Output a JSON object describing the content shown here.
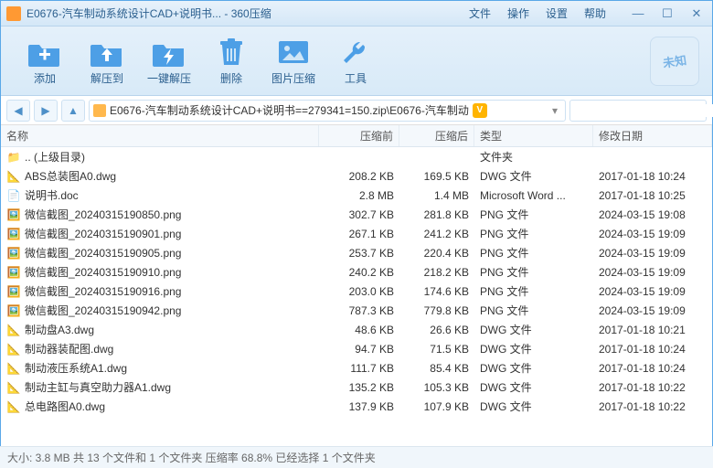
{
  "title": "E0676-汽车制动系统设计CAD+说明书... - 360压缩",
  "menu": {
    "file": "文件",
    "op": "操作",
    "set": "设置",
    "help": "帮助"
  },
  "tools": {
    "add": "添加",
    "extract": "解压到",
    "oneclick": "一键解压",
    "delete": "删除",
    "imgcomp": "图片压缩",
    "toolbox": "工具"
  },
  "badge": "未知",
  "path": "E0676-汽车制动系统设计CAD+说明书==279341=150.zip\\E0676-汽车制动",
  "vip": "V",
  "cols": {
    "name": "名称",
    "before": "压缩前",
    "after": "压缩后",
    "type": "类型",
    "date": "修改日期"
  },
  "rows": [
    {
      "icon": "folder",
      "name": ".. (上级目录)",
      "before": "",
      "after": "",
      "type": "文件夹",
      "date": ""
    },
    {
      "icon": "dwg",
      "name": "ABS总装图A0.dwg",
      "before": "208.2 KB",
      "after": "169.5 KB",
      "type": "DWG 文件",
      "date": "2017-01-18 10:24"
    },
    {
      "icon": "doc",
      "name": "说明书.doc",
      "before": "2.8 MB",
      "after": "1.4 MB",
      "type": "Microsoft Word ...",
      "date": "2017-01-18 10:25"
    },
    {
      "icon": "png",
      "name": "微信截图_20240315190850.png",
      "before": "302.7 KB",
      "after": "281.8 KB",
      "type": "PNG 文件",
      "date": "2024-03-15 19:08"
    },
    {
      "icon": "png",
      "name": "微信截图_20240315190901.png",
      "before": "267.1 KB",
      "after": "241.2 KB",
      "type": "PNG 文件",
      "date": "2024-03-15 19:09"
    },
    {
      "icon": "png",
      "name": "微信截图_20240315190905.png",
      "before": "253.7 KB",
      "after": "220.4 KB",
      "type": "PNG 文件",
      "date": "2024-03-15 19:09"
    },
    {
      "icon": "png",
      "name": "微信截图_20240315190910.png",
      "before": "240.2 KB",
      "after": "218.2 KB",
      "type": "PNG 文件",
      "date": "2024-03-15 19:09"
    },
    {
      "icon": "png",
      "name": "微信截图_20240315190916.png",
      "before": "203.0 KB",
      "after": "174.6 KB",
      "type": "PNG 文件",
      "date": "2024-03-15 19:09"
    },
    {
      "icon": "png",
      "name": "微信截图_20240315190942.png",
      "before": "787.3 KB",
      "after": "779.8 KB",
      "type": "PNG 文件",
      "date": "2024-03-15 19:09"
    },
    {
      "icon": "dwg",
      "name": "制动盘A3.dwg",
      "before": "48.6 KB",
      "after": "26.6 KB",
      "type": "DWG 文件",
      "date": "2017-01-18 10:21"
    },
    {
      "icon": "dwg",
      "name": "制动器装配图.dwg",
      "before": "94.7 KB",
      "after": "71.5 KB",
      "type": "DWG 文件",
      "date": "2017-01-18 10:24"
    },
    {
      "icon": "dwg",
      "name": "制动液压系统A1.dwg",
      "before": "111.7 KB",
      "after": "85.4 KB",
      "type": "DWG 文件",
      "date": "2017-01-18 10:24"
    },
    {
      "icon": "dwg",
      "name": "制动主缸与真空助力器A1.dwg",
      "before": "135.2 KB",
      "after": "105.3 KB",
      "type": "DWG 文件",
      "date": "2017-01-18 10:22"
    },
    {
      "icon": "dwg",
      "name": "总电路图A0.dwg",
      "before": "137.9 KB",
      "after": "107.9 KB",
      "type": "DWG 文件",
      "date": "2017-01-18 10:22"
    }
  ],
  "status": "大小: 3.8 MB 共 13 个文件和 1 个文件夹 压缩率 68.8%  已经选择 1 个文件夹"
}
